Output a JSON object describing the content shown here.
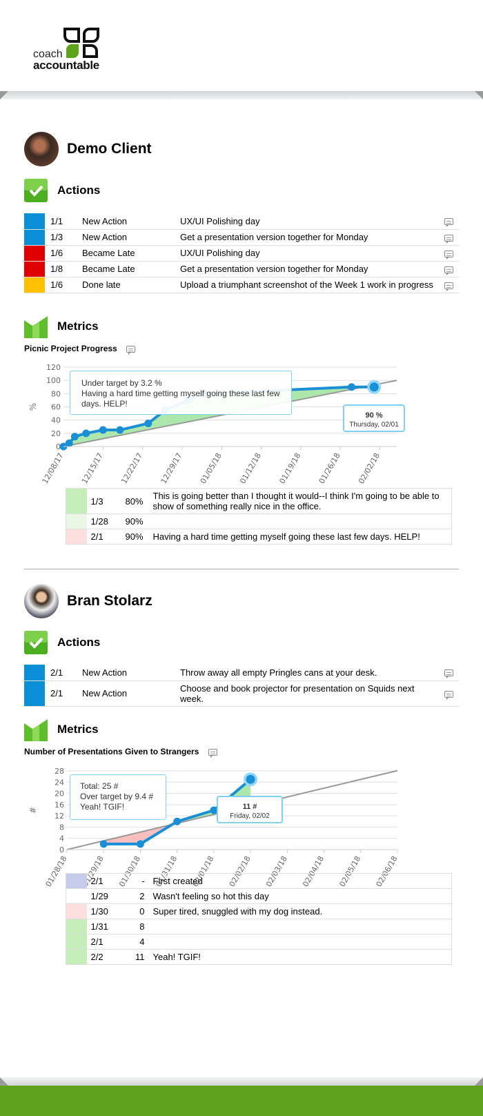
{
  "brand": {
    "line1": "coach",
    "line2": "accountable",
    "green": "#5fa31c"
  },
  "colors": {
    "blue": "#0b8fd6",
    "red": "#e00000",
    "yellow": "#ffc000",
    "green_light": "#c6eeb8",
    "green_pale": "#eaf7e4",
    "pink": "#fcdede",
    "lavender": "#c6cce9",
    "line": "#1a8fd6",
    "target": "#999999"
  },
  "clients": [
    {
      "name": "Demo Client",
      "actions_label": "Actions",
      "actions": [
        {
          "color": "blue",
          "date": "1/1",
          "type": "New Action",
          "text": "UX/UI Polishing day"
        },
        {
          "color": "blue",
          "date": "1/3",
          "type": "New Action",
          "text": "Get a presentation version together for Monday"
        },
        {
          "color": "red",
          "date": "1/6",
          "type": "Became Late",
          "text": "UX/UI Polishing day"
        },
        {
          "color": "red",
          "date": "1/8",
          "type": "Became Late",
          "text": "Get a presentation version together for Monday"
        },
        {
          "color": "yellow",
          "date": "1/6",
          "type": "Done late",
          "text": "Upload a triumphant screenshot of the Week 1 work in progress"
        }
      ],
      "metrics_label": "Metrics",
      "metric": {
        "title": "Picnic Project Progress",
        "tooltip_lines": [
          "Under target by 3.2 %",
          "Having a hard time getting myself going these last few days. HELP!"
        ],
        "hover_value": "90 %",
        "hover_date": "Thursday, 02/01",
        "entries": [
          {
            "color": "green_light",
            "date": "1/3",
            "value": "80%",
            "note": "This is going better than I thought it would--I think I'm going to be able to show of something really nice in the office."
          },
          {
            "color": "green_pale",
            "date": "1/28",
            "value": "90%",
            "note": ""
          },
          {
            "color": "pink",
            "date": "2/1",
            "value": "90%",
            "note": "Having a hard time getting myself going these last few days. HELP!"
          }
        ]
      }
    },
    {
      "name": "Bran Stolarz",
      "actions_label": "Actions",
      "actions": [
        {
          "color": "blue",
          "date": "2/1",
          "type": "New Action",
          "text": "Throw away all empty Pringles cans at your desk."
        },
        {
          "color": "blue",
          "date": "2/1",
          "type": "New Action",
          "text": "Choose and book projector for presentation on Squids next week."
        }
      ],
      "metrics_label": "Metrics",
      "metric": {
        "title": "Number of Presentations Given to Strangers",
        "tooltip_lines": [
          "Total: 25 #",
          "Over target by 9.4 #",
          "Yeah! TGIF!"
        ],
        "hover_value": "11 #",
        "hover_date": "Friday, 02/02",
        "entries": [
          {
            "color": "lavender",
            "date": "2/1",
            "value": "-",
            "note": "First created"
          },
          {
            "color": "white",
            "date": "1/29",
            "value": "2",
            "note": "Wasn't feeling so hot this day"
          },
          {
            "color": "pink",
            "date": "1/30",
            "value": "0",
            "note": "Super tired, snuggled with my dog instead."
          },
          {
            "color": "green_light",
            "date": "1/31",
            "value": "8",
            "note": ""
          },
          {
            "color": "green_light",
            "date": "2/1",
            "value": "4",
            "note": ""
          },
          {
            "color": "green_light",
            "date": "2/2",
            "value": "11",
            "note": "Yeah! TGIF!"
          }
        ]
      }
    }
  ],
  "chart_data": [
    {
      "type": "line",
      "title": "Picnic Project Progress",
      "ylabel": "%",
      "ylim": [
        0,
        120
      ],
      "yticks": [
        0,
        20,
        40,
        60,
        80,
        100,
        120
      ],
      "xlim": [
        "2017-12-08",
        "2018-02-05"
      ],
      "xticks": [
        "12/08/17",
        "12/15/17",
        "12/22/17",
        "12/29/17",
        "01/05/18",
        "01/12/18",
        "01/19/18",
        "01/26/18",
        "02/02/18"
      ],
      "series": [
        {
          "values": [
            [
              "2017-12-08",
              0
            ],
            [
              "2017-12-09",
              5
            ],
            [
              "2017-12-10",
              15
            ],
            [
              "2017-12-12",
              20
            ],
            [
              "2017-12-15",
              25
            ],
            [
              "2017-12-18",
              25
            ],
            [
              "2017-12-23",
              35
            ],
            [
              "2017-12-26",
              55
            ],
            [
              "2017-12-30",
              70
            ],
            [
              "2018-01-02",
              80
            ],
            [
              "2018-01-28",
              90
            ],
            [
              "2018-02-01",
              90
            ]
          ]
        }
      ],
      "target": [
        [
          "2017-12-08",
          0
        ],
        [
          "2018-02-05",
          100
        ]
      ],
      "highlight": "2018-02-01",
      "grid": true
    },
    {
      "type": "line",
      "title": "Number of Presentations Given to Strangers",
      "ylabel": "#",
      "ylim": [
        0,
        28
      ],
      "yticks": [
        0,
        4,
        8,
        12,
        16,
        20,
        24,
        28
      ],
      "xlim": [
        "2018-01-28",
        "2018-02-06"
      ],
      "xticks": [
        "01/28/18",
        "01/29/18",
        "01/30/18",
        "01/31/18",
        "02/01/18",
        "02/02/18",
        "02/03/18",
        "02/04/18",
        "02/05/18",
        "02/06/18"
      ],
      "series": [
        {
          "values": [
            [
              "2018-01-29",
              2
            ],
            [
              "2018-01-30",
              2
            ],
            [
              "2018-01-31",
              10
            ],
            [
              "2018-02-01",
              14
            ],
            [
              "2018-02-02",
              25
            ]
          ]
        }
      ],
      "target": [
        [
          "2018-01-28",
          0
        ],
        [
          "2018-02-06",
          28.1
        ]
      ],
      "highlight": "2018-02-02",
      "grid": true
    }
  ]
}
